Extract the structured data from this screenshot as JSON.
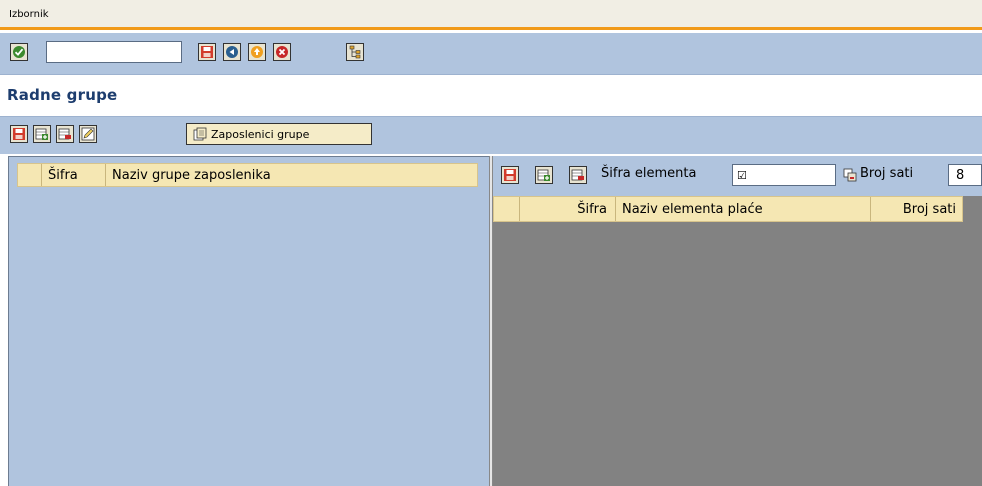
{
  "menubar": {
    "menu_label": "Izbornik"
  },
  "system_toolbar": {
    "command_field_value": "",
    "buttons": [
      "enter-icon",
      "save-icon",
      "back-icon",
      "exit-icon",
      "cancel-icon",
      "hierarchy-icon"
    ]
  },
  "page": {
    "title": "Radne grupe"
  },
  "app_toolbar": {
    "zaposlenici_label": "Zaposlenici grupe"
  },
  "left_table": {
    "columns": [
      "Šifra",
      "Naziv grupe zaposlenika"
    ]
  },
  "right_toolbar": {
    "sifra_label": "Šifra elementa",
    "sifra_value": "☑",
    "broj_label": "Broj sati",
    "broj_value": "8"
  },
  "right_table": {
    "columns": [
      "Šifra",
      "Naziv elementa plaće",
      "Broj sati"
    ]
  },
  "colors": {
    "toolbar_bg": "#b0c4de",
    "menubar_bg": "#f1eee4",
    "accent": "#f19a19",
    "header_bg": "#f5e7b3",
    "empty_area": "#828282",
    "title": "#1d3d6e"
  }
}
